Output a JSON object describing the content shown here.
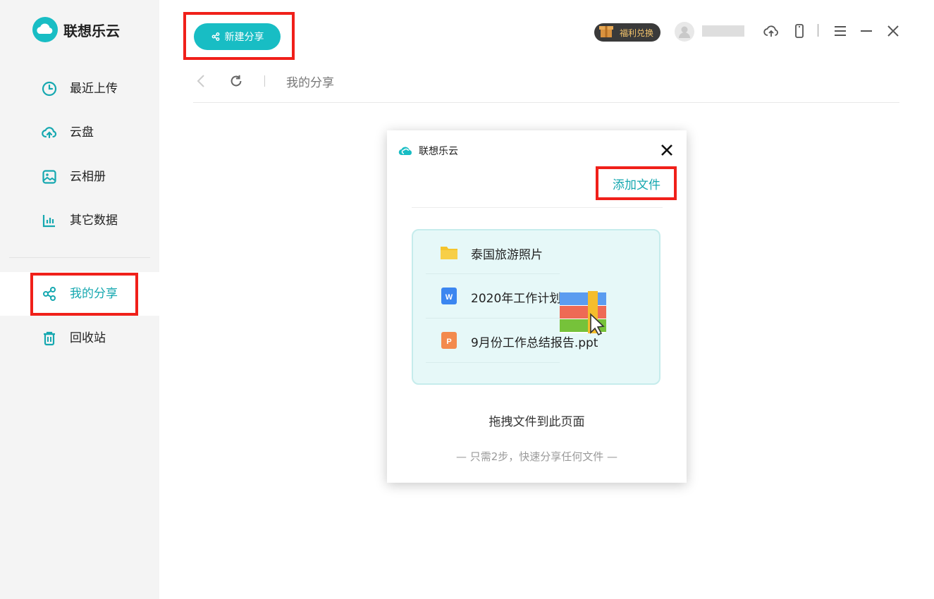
{
  "app": {
    "title": "联想乐云"
  },
  "sidebar": {
    "items": [
      {
        "label": "最近上传",
        "icon": "clock-icon"
      },
      {
        "label": "云盘",
        "icon": "cloud-upload-icon"
      },
      {
        "label": "云相册",
        "icon": "image-icon"
      },
      {
        "label": "其它数据",
        "icon": "bar-chart-icon"
      },
      {
        "label": "我的分享",
        "icon": "share-icon"
      },
      {
        "label": "回收站",
        "icon": "trash-icon"
      }
    ],
    "active_index": 4
  },
  "toolbar": {
    "new_share_label": "新建分享",
    "bonus_label": "福利兑换"
  },
  "breadcrumb": {
    "current": "我的分享"
  },
  "dialog": {
    "title": "联想乐云",
    "add_file_label": "添加文件",
    "files": [
      {
        "name": "泰国旅游照片",
        "icon": "folder-icon"
      },
      {
        "name": "2020年工作计划...",
        "icon": "word-doc-icon"
      },
      {
        "name": "9月份工作总结报告.ppt",
        "icon": "ppt-icon"
      }
    ],
    "drag_hint": "拖拽文件到此页面",
    "step_hint": "— 只需2步，快速分享任何文件 —"
  },
  "colors": {
    "accent": "#18bdc4",
    "highlight": "#f0201a",
    "sidebar_bg": "#f4f4f4"
  }
}
